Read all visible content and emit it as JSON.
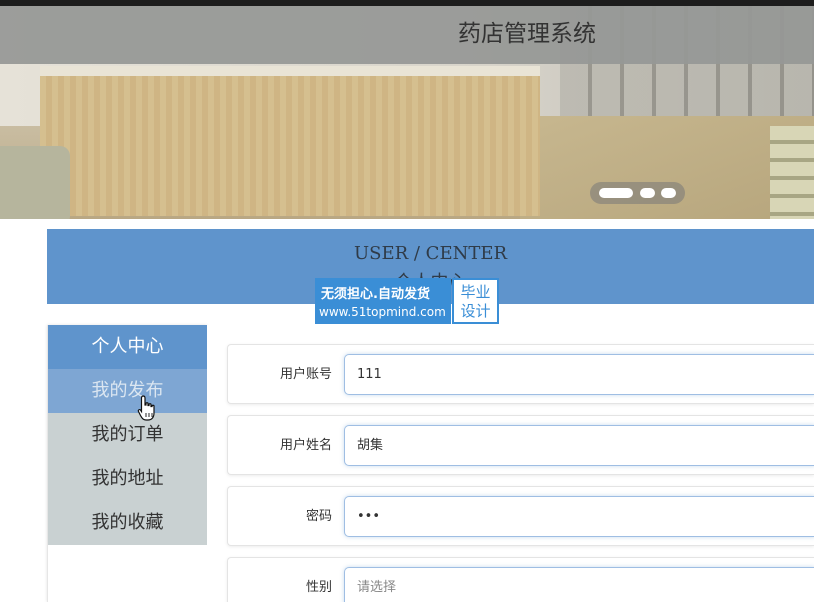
{
  "header": {
    "title": "药店管理系统"
  },
  "user_center": {
    "title_en": "USER / CENTER",
    "title_cn": "个人中心"
  },
  "watermark": {
    "line1": "无须担心.自动发货",
    "line2": "www.51topmind.com",
    "badge_line1": "毕业",
    "badge_line2": "设计"
  },
  "sidebar": {
    "items": [
      {
        "label": "个人中心",
        "state": "active"
      },
      {
        "label": "我的发布",
        "state": "hover"
      },
      {
        "label": "我的订单",
        "state": "normal"
      },
      {
        "label": "我的地址",
        "state": "normal"
      },
      {
        "label": "我的收藏",
        "state": "normal"
      }
    ]
  },
  "form": {
    "fields": [
      {
        "label": "用户账号",
        "value": "111"
      },
      {
        "label": "用户姓名",
        "value": "胡集"
      },
      {
        "label": "密码",
        "value": "•••"
      },
      {
        "label": "性别",
        "placeholder": "请选择"
      }
    ]
  },
  "colors": {
    "accent": "#5f94cc",
    "header_bg": "#969896",
    "sidebar_gray": "#c9d1d2"
  }
}
